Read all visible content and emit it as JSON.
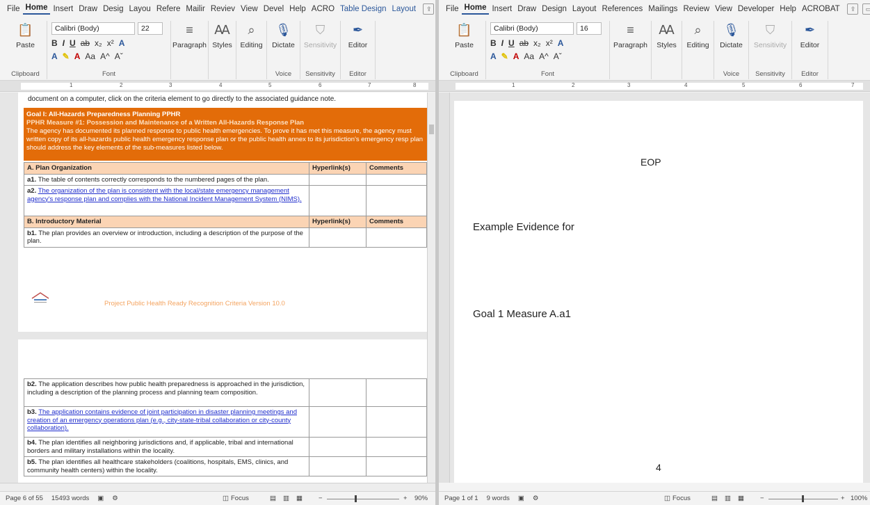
{
  "left": {
    "menu": {
      "tabs": [
        "File",
        "Home",
        "Insert",
        "Draw",
        "Desig",
        "Layou",
        "Refere",
        "Mailir",
        "Reviev",
        "View",
        "Devel",
        "Help",
        "ACRO",
        "Table Design",
        "Layout"
      ],
      "active_tab": "Home"
    },
    "ribbon": {
      "paste": "Paste",
      "font_name": "Calibri (Body)",
      "font_size": "22",
      "paragraph": "Paragraph",
      "styles": "Styles",
      "editing": "Editing",
      "dictate": "Dictate",
      "sensitivity": "Sensitivity",
      "editor": "Editor",
      "groups": {
        "clipboard": "Clipboard",
        "font": "Font",
        "voice": "Voice",
        "sensitivity": "Sensitivity",
        "editor": "Editor"
      }
    },
    "doc": {
      "intro": "document on a computer, click on the criteria element to go directly to the associated guidance note.",
      "goal_title": "Goal I: All-Hazards Preparedness Planning PPHR",
      "measure": "PPHR Measure #1: Possession and Maintenance of a Written All-Hazards Response Plan",
      "goal_desc": "The agency has documented its planned response to public health emergencies. To prove it has met this measure, the agency must written copy of its all-hazards public health emergency response plan or the public health annex to its jurisdiction's emergency resp plan should address the key elements of the sub-measures listed below.",
      "col_hyperlinks": "Hyperlink(s)",
      "col_comments": "Comments",
      "section_a": "A.  Plan Organization",
      "a1_code": "a1.",
      "a1_text": "The table of contents correctly corresponds to the numbered pages of the plan.",
      "a2_code": "a2.",
      "a2_text": "The organization of the plan is consistent with the local/state emergency management agency's response plan and complies with the National Incident Management System (NIMS).",
      "section_b": "B.  Introductory Material",
      "b1_code": "b1.",
      "b1_text": "The plan provides an overview or introduction, including a description of the purpose of the plan.",
      "footer_text": "Project Public Health Ready Recognition Criteria Version 10.0",
      "b2_code": "b2.",
      "b2_text": "The application describes how public health preparedness is approached in the jurisdiction, including a description of the planning process and planning team composition.",
      "b3_code": "b3.",
      "b3_text": "The application contains evidence of joint participation in disaster planning meetings and creation of an emergency operations plan (e.g., city-state-tribal collaboration or city-county collaboration).",
      "b4_code": "b4.",
      "b4_text": "The plan identifies all neighboring jurisdictions and, if applicable, tribal and international borders and military installations within the locality.",
      "b5_code": "b5.",
      "b5_text": "The plan identifies all healthcare stakeholders (coalitions, hospitals, EMS, clinics, and community health centers) within the locality."
    },
    "status": {
      "page": "Page 6 of 55",
      "words": "15493 words",
      "focus": "Focus",
      "zoom": "90%"
    }
  },
  "right": {
    "menu": {
      "tabs": [
        "File",
        "Home",
        "Insert",
        "Draw",
        "Design",
        "Layout",
        "References",
        "Mailings",
        "Review",
        "View",
        "Developer",
        "Help",
        "ACROBAT"
      ],
      "active_tab": "Home"
    },
    "ribbon": {
      "paste": "Paste",
      "font_name": "Calibri (Body)",
      "font_size": "16",
      "paragraph": "Paragraph",
      "styles": "Styles",
      "editing": "Editing",
      "dictate": "Dictate",
      "sensitivity": "Sensitivity",
      "editor": "Editor",
      "groups": {
        "clipboard": "Clipboard",
        "font": "Font",
        "voice": "Voice",
        "sensitivity": "Sensitivity",
        "editor": "Editor"
      }
    },
    "doc": {
      "line1": "EOP",
      "line2": "Example Evidence for",
      "line3": "Goal 1 Measure A.a1",
      "page_number": "4"
    },
    "status": {
      "page": "Page 1 of 1",
      "words": "9 words",
      "focus": "Focus",
      "zoom": "100%"
    }
  }
}
